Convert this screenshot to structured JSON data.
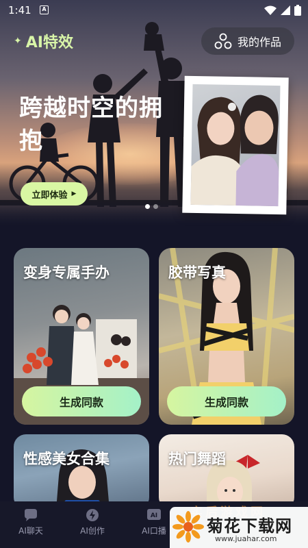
{
  "status_bar": {
    "time": "1:41",
    "notification_badge": "A"
  },
  "header": {
    "app_title": "AI特效",
    "my_works_label": "我的作品"
  },
  "hero": {
    "headline": "跨越时空的拥抱",
    "cta_label": "立即体验",
    "carousel": {
      "pages": 2,
      "active_page": 1
    }
  },
  "cards": [
    {
      "title": "变身专属手办",
      "button_label": "生成同款"
    },
    {
      "title": "胶带写真",
      "button_label": "生成同款"
    },
    {
      "title": "性感美女合集"
    },
    {
      "title": "热门舞蹈"
    }
  ],
  "bottom_nav": [
    {
      "label": "AI聊天",
      "icon": "chat-bubble-icon"
    },
    {
      "label": "AI创作",
      "icon": "lightning-icon"
    },
    {
      "label": "AI口播",
      "icon": "ai-badge-icon"
    }
  ],
  "watermark": {
    "title": "菊花下载网",
    "url": "www.juahar.com",
    "ghost_text": "实后游戏网"
  },
  "colors": {
    "accent_green": "#d9f7a3",
    "background": "#141528",
    "button_gradient_end": "#a4f1c8"
  }
}
